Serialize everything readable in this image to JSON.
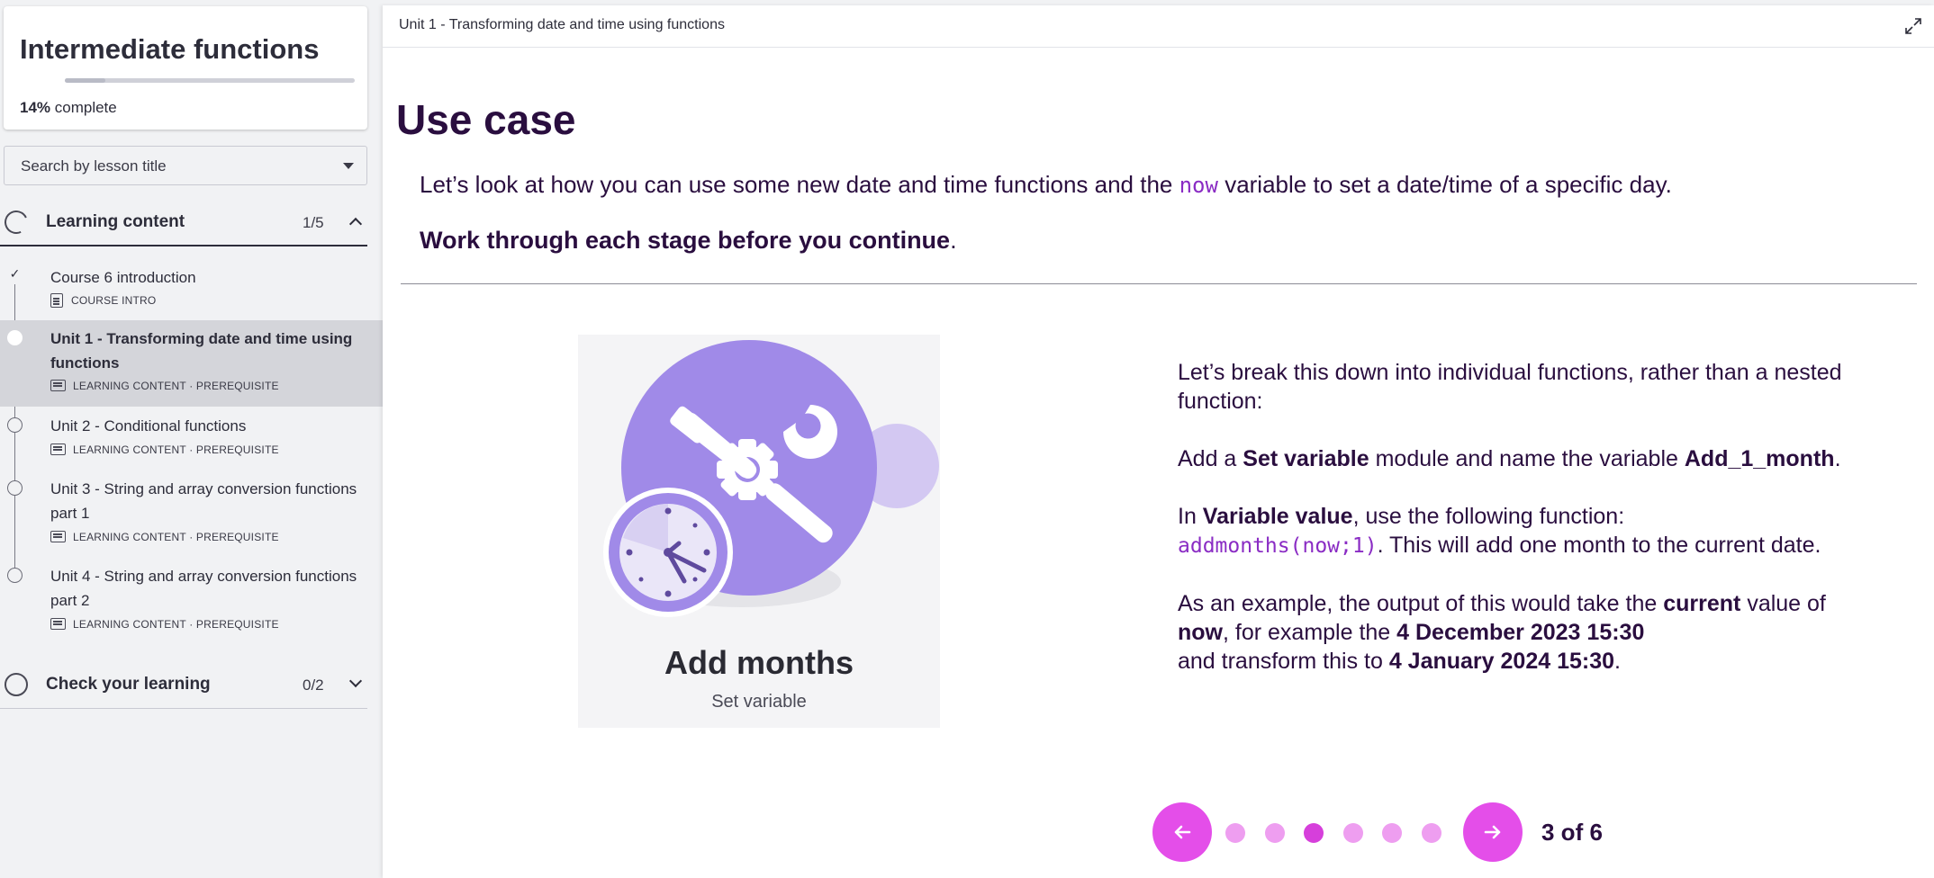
{
  "course": {
    "title": "Intermediate functions",
    "progress_percent": 14,
    "progress_value": "14%",
    "progress_suffix": " complete"
  },
  "search": {
    "placeholder": "Search by lesson title"
  },
  "sections": [
    {
      "title": "Learning content",
      "count": "1/5"
    },
    {
      "title": "Check your learning",
      "count": "0/2"
    }
  ],
  "lessons": [
    {
      "title": "Course 6 introduction",
      "meta": "COURSE INTRO",
      "status": "completed"
    },
    {
      "title": "Unit 1 - Transforming date and time using functions",
      "meta": "LEARNING CONTENT · PREREQUISITE",
      "status": "current"
    },
    {
      "title": "Unit 2 - Conditional functions",
      "meta": "LEARNING CONTENT · PREREQUISITE",
      "status": "not-started"
    },
    {
      "title": "Unit 3 - String and array conversion functions part 1",
      "meta": "LEARNING CONTENT · PREREQUISITE",
      "status": "not-started"
    },
    {
      "title": "Unit 4 - String and array conversion functions part 2",
      "meta": "LEARNING CONTENT · PREREQUISITE",
      "status": "not-started"
    }
  ],
  "main": {
    "breadcrumb": "Unit 1 - Transforming date and time using functions",
    "heading": "Use case",
    "intro_before": "Let’s look at how you can use some new date and time functions and the ",
    "intro_code": "now",
    "intro_after": " variable to set a date/time of a specific day.",
    "emphasis": "Work through each stage before you continue",
    "emphasis_suffix": "."
  },
  "illustration": {
    "title": "Add months",
    "subtitle": "Set variable",
    "icon": "tools-gear-clock-icon"
  },
  "description": {
    "p1": "Let’s break this down into individual functions, rather than a nested function:",
    "p2_a": "Add a ",
    "p2_b": "Set variable",
    "p2_c": " module and name the variable ",
    "p2_d": "Add_1_month",
    "p2_e": ".",
    "p3_a": "In ",
    "p3_b": "Variable value",
    "p3_c": ", use the following function:",
    "p3_code": "addmonths(now;1)",
    "p3_d": ". This will add one month to the current date.",
    "p4_a": "As an example, the output of this would take the ",
    "p4_b": "current",
    "p4_c": " value of ",
    "p4_d": "now",
    "p4_e": ", for example the ",
    "p4_f": "4 December 2023 15:30",
    "p4_g": "and transform this to ",
    "p4_h": "4 January 2024 15:30",
    "p4_i": "."
  },
  "pager": {
    "label": "3 of 6",
    "total": 6,
    "current": 3
  },
  "colors": {
    "accent": "#e44ee9",
    "dot_inactive": "#ee9ef0",
    "dot_active": "#d63fdb",
    "heading": "#2a0e3f",
    "code": "#8a2cc4",
    "illustration_purple": "#a08ae8"
  }
}
